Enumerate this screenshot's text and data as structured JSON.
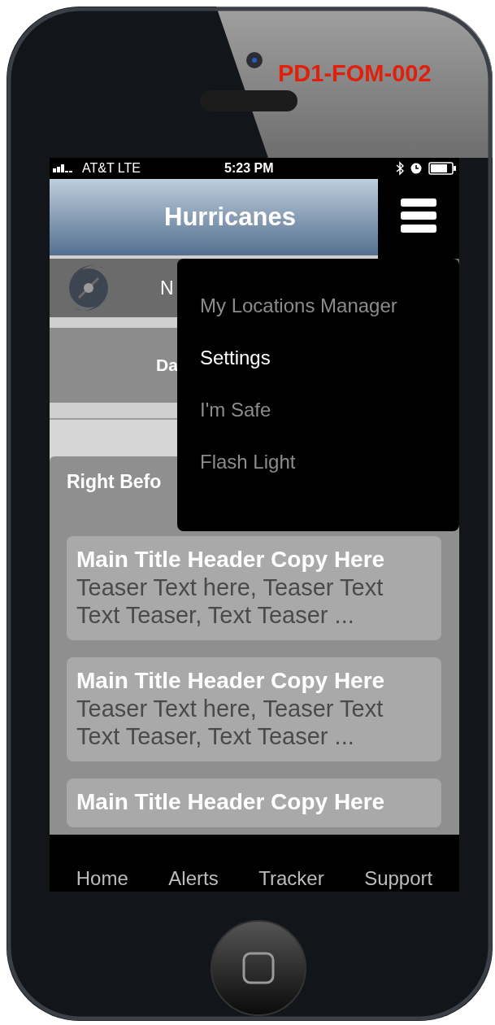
{
  "annotation": {
    "label": "PD1-FOM-002"
  },
  "status_bar": {
    "carrier": "AT&T LTE",
    "time": "5:23 PM"
  },
  "header": {
    "title": "Hurricanes"
  },
  "rows": [
    {
      "kind": "icon_row",
      "text": "N"
    },
    {
      "kind": "plain",
      "text": "Da"
    }
  ],
  "section": {
    "title": "Right Befo",
    "cards": [
      {
        "title": "Main Title Header Copy Here",
        "teaser": "Teaser Text here, Teaser Text Text Teaser, Text Teaser ..."
      },
      {
        "title": "Main Title Header Copy Here",
        "teaser": "Teaser Text here, Teaser Text Text Teaser, Text Teaser ..."
      },
      {
        "title": "Main Title Header Copy Here"
      }
    ]
  },
  "menu": {
    "items": [
      {
        "label": "My Locations Manager",
        "selected": false
      },
      {
        "label": "Settings",
        "selected": true
      },
      {
        "label": "I'm Safe",
        "selected": false
      },
      {
        "label": "Flash Light",
        "selected": false
      }
    ]
  },
  "tab_bar": {
    "tabs": [
      "Home",
      "Alerts",
      "Tracker",
      "Support"
    ]
  }
}
